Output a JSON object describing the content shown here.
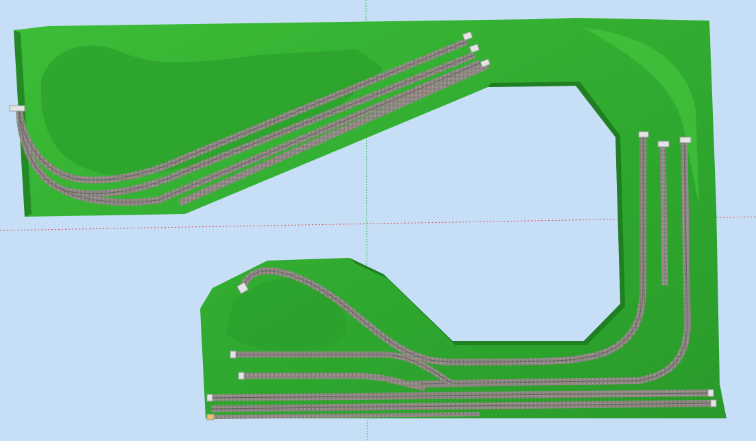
{
  "viewport": {
    "background": "#c6dff6",
    "axis_green": "#33c24a",
    "axis_red": "#e0454a"
  },
  "layout_model": {
    "terrain_color": "#2fa82f",
    "terrain_highlight": "#3fc03a",
    "terrain_shadow": "#1f7f22",
    "ballast_color": "#8f8a86",
    "rail_color": "#6a6a6a",
    "buffer_color": "#e8e8e8"
  }
}
